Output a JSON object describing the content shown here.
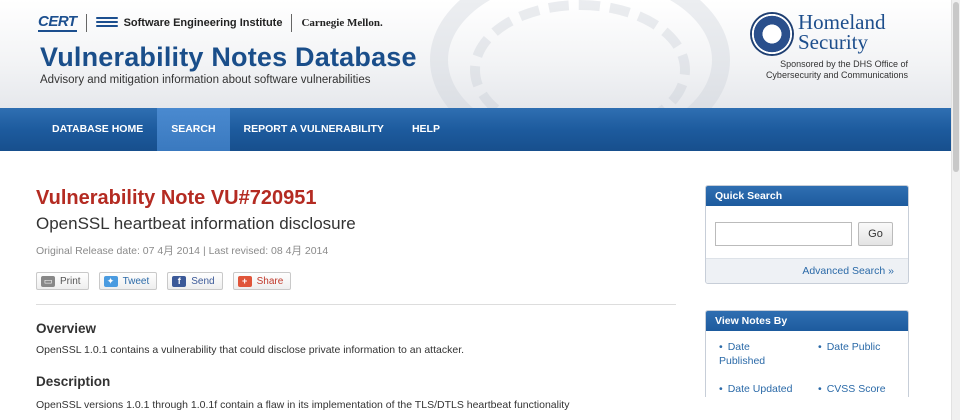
{
  "header": {
    "cert_logo": "CERT",
    "sei_name": "Software Engineering Institute",
    "cmu_name": "Carnegie Mellon.",
    "site_title": "Vulnerability Notes Database",
    "site_subtitle": "Advisory and mitigation information about software vulnerabilities",
    "dhs_name_line1": "Homeland",
    "dhs_name_line2": "Security",
    "dhs_sponsor_line1": "Sponsored by the DHS Office of",
    "dhs_sponsor_line2": "Cybersecurity and Communications"
  },
  "nav": {
    "items": [
      {
        "label": "DATABASE HOME",
        "active": false
      },
      {
        "label": "SEARCH",
        "active": true
      },
      {
        "label": "REPORT A VULNERABILITY",
        "active": false
      },
      {
        "label": "HELP",
        "active": false
      }
    ]
  },
  "note": {
    "title": "Vulnerability Note VU#720951",
    "subtitle": "OpenSSL heartbeat information disclosure",
    "dates": "Original Release date: 07 4月 2014 | Last revised: 08 4月 2014",
    "share": {
      "print": "Print",
      "tweet": "Tweet",
      "send": "Send",
      "share": "Share"
    },
    "overview_heading": "Overview",
    "overview_text": "OpenSSL 1.0.1 contains a vulnerability that could disclose private information to an attacker.",
    "description_heading": "Description",
    "description_text": "OpenSSL versions 1.0.1 through 1.0.1f contain a flaw in its implementation of the TLS/DTLS heartbeat functionality"
  },
  "sidebar": {
    "quick_search": {
      "title": "Quick Search",
      "input_value": "",
      "go_label": "Go",
      "advanced_link": "Advanced Search »"
    },
    "view_notes": {
      "title": "View Notes By",
      "items": [
        "Date Published",
        "Date Public",
        "Date Updated",
        "CVSS Score"
      ]
    }
  },
  "colors": {
    "brand_blue": "#1a4e8a",
    "nav_blue": "#1d5b9e",
    "nav_active": "#3a79bf",
    "title_red": "#b42b22",
    "link_blue": "#2b6aa8"
  }
}
